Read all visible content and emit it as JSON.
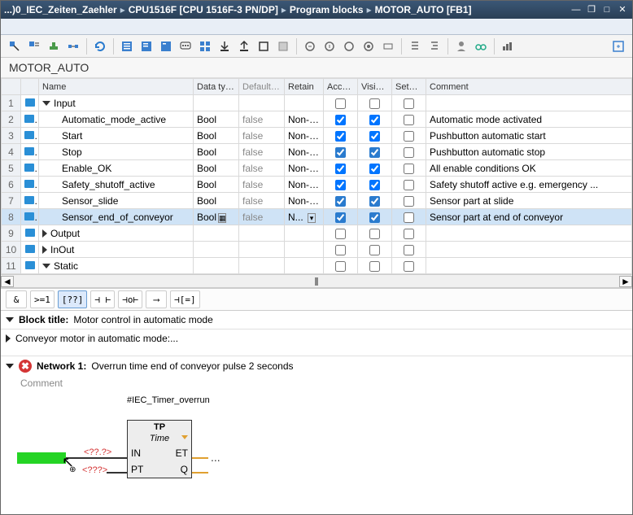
{
  "titlebar": {
    "crumb1": "...)0_IEC_Zeiten_Zaehler",
    "crumb2": "CPU1516F [CPU 1516F-3 PN/DP]",
    "crumb3": "Program blocks",
    "crumb4": "MOTOR_AUTO [FB1]",
    "sep": "▸"
  },
  "block_name": "MOTOR_AUTO",
  "columns": {
    "name": "Name",
    "dt": "Data type",
    "def": "Default ...",
    "ret": "Retain",
    "acc": "Acces...",
    "vis": "Visibl...",
    "set": "Setpo...",
    "cmt": "Comment"
  },
  "sections": {
    "input": "Input",
    "output": "Output",
    "inout": "InOut",
    "static": "Static"
  },
  "rows": [
    {
      "n": "2",
      "name": "Automatic_mode_active",
      "dt": "Bool",
      "def": "false",
      "ret": "Non-r...",
      "acc": true,
      "vis": true,
      "set": false,
      "cmt": "Automatic mode activated"
    },
    {
      "n": "3",
      "name": "Start",
      "dt": "Bool",
      "def": "false",
      "ret": "Non-r...",
      "acc": true,
      "vis": true,
      "set": false,
      "cmt": "Pushbutton automatic start"
    },
    {
      "n": "4",
      "name": "Stop",
      "dt": "Bool",
      "def": "false",
      "ret": "Non-r...",
      "acc": true,
      "vis": true,
      "set": false,
      "cmt": "Pushbutton automatic stop",
      "badge": true
    },
    {
      "n": "5",
      "name": "Enable_OK",
      "dt": "Bool",
      "def": "false",
      "ret": "Non-r...",
      "acc": true,
      "vis": true,
      "set": false,
      "cmt": "All enable conditions OK"
    },
    {
      "n": "6",
      "name": "Safety_shutoff_active",
      "dt": "Bool",
      "def": "false",
      "ret": "Non-r...",
      "acc": true,
      "vis": true,
      "set": false,
      "cmt": "Safety shutoff active e.g. emergency ..."
    },
    {
      "n": "7",
      "name": "Sensor_slide",
      "dt": "Bool",
      "def": "false",
      "ret": "Non-r...",
      "acc": true,
      "vis": true,
      "set": false,
      "cmt": "Sensor part at slide",
      "badge": true
    },
    {
      "n": "8",
      "name": "Sensor_end_of_conveyor",
      "dt": "Bool",
      "def": "false",
      "ret": "N...",
      "acc": true,
      "vis": true,
      "set": false,
      "cmt": "Sensor part at end of conveyor",
      "sel": true,
      "badge": true
    }
  ],
  "blocktitle_label": "Block title:",
  "blocktitle_text": "Motor control in automatic mode",
  "subtitle": "Conveyor motor in automatic mode:...",
  "network_label": "Network 1:",
  "network_text": "Overrun time end of conveyor pulse 2 seconds",
  "comment_label": "Comment",
  "instance_label": "#IEC_Timer_overrun",
  "tp": {
    "title": "TP",
    "sub": "Time",
    "in": "IN",
    "pt": "PT",
    "et": "ET",
    "q": "Q"
  },
  "operands": {
    "in": "<??.?>",
    "pt": "<???>",
    "et": "..."
  },
  "lad": {
    "and": "&",
    "ge": ">=1",
    "box": "[??]",
    "no": "⊣ ⊢",
    "nc": "⊣o⊢",
    "coil": "⟶",
    "branch": "⊣[=]"
  }
}
